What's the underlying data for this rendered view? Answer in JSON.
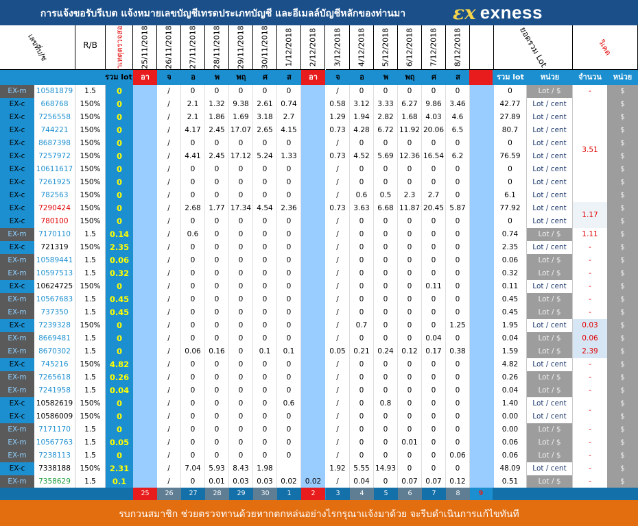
{
  "banner": {
    "text": "การแจ้งขอรับรีเบต   แจ้งหมายเลขบัญชีเทรดประเภทบัญชี และอีเมลล์บัญชีหลักของท่านมา",
    "brand_icon": "ex-logo-icon",
    "brand_name": "exness"
  },
  "headers": {
    "account": "เลขที่บ/ช",
    "rb": "R/B",
    "monthly": "สาเหตุตรวจสอบ",
    "dates": [
      "25/11/2018",
      "26/11/2018",
      "27/11/2018",
      "28/11/2018",
      "29/11/2018",
      "30/11/2018",
      "1/12/2018",
      "2/12/2018",
      "3/12/2018",
      "4/12/2018",
      "5/12/2018",
      "6/12/2018",
      "7/12/2018",
      "8/12/2018"
    ],
    "total": "ยอดรวม Lot",
    "withdraw": "วิเคด"
  },
  "dayrow": {
    "sum_label": "รวม lot",
    "days": [
      "อา",
      "จ",
      "อ",
      "พ",
      "พฤ",
      "ศ",
      "ส",
      "อา",
      "จ",
      "อ",
      "พ",
      "พฤ",
      "ศ",
      "ส"
    ],
    "total_label": "รวม lot",
    "unit_label": "หน่วย",
    "amount_label": "จำนวนเงิน",
    "currency_label": "หน่วย"
  },
  "rows": [
    {
      "type": "EX-m",
      "acc": "10581879",
      "rb": "1.5",
      "sum": "0",
      "d": [
        "",
        "/",
        "0",
        "0",
        "0",
        "0",
        "0",
        "",
        "/",
        "0",
        "0",
        "0",
        "0",
        "0"
      ],
      "tot": "0",
      "unit": "Lot / $",
      "amt": "-",
      "cur": "$"
    },
    {
      "type": "EX-c",
      "acc": "668768",
      "rb": "150%",
      "sum": "0",
      "d": [
        "",
        "/",
        "2.1",
        "1.32",
        "9.38",
        "2.61",
        "0.74",
        "",
        "0.58",
        "3.12",
        "3.33",
        "6.27",
        "9.86",
        "3.46"
      ],
      "tot": "42.77",
      "unit": "Lot / cent",
      "amt": "",
      "cur": "$"
    },
    {
      "type": "EX-c",
      "acc": "7256558",
      "rb": "150%",
      "sum": "0",
      "d": [
        "",
        "/",
        "2.1",
        "1.86",
        "1.69",
        "3.18",
        "2.7",
        "",
        "1.29",
        "1.94",
        "2.82",
        "1.68",
        "4.03",
        "4.6"
      ],
      "tot": "27.89",
      "unit": "Lot / cent",
      "amt": "",
      "cur": "$"
    },
    {
      "type": "EX-c",
      "acc": "744221",
      "rb": "150%",
      "sum": "0",
      "d": [
        "",
        "/",
        "4.17",
        "2.45",
        "17.07",
        "2.65",
        "4.15",
        "",
        "0.73",
        "4.28",
        "6.72",
        "11.92",
        "20.06",
        "6.5"
      ],
      "tot": "80.7",
      "unit": "Lot / cent",
      "amt": "",
      "cur": "$"
    },
    {
      "type": "EX-c",
      "acc": "8687398",
      "rb": "150%",
      "sum": "0",
      "d": [
        "",
        "/",
        "0",
        "0",
        "0",
        "0",
        "0",
        "",
        "/",
        "0",
        "0",
        "0",
        "0",
        "0"
      ],
      "tot": "0",
      "unit": "Lot / cent",
      "amt": "",
      "cur": "$"
    },
    {
      "type": "EX-c",
      "acc": "7257972",
      "rb": "150%",
      "sum": "0",
      "d": [
        "",
        "/",
        "4.41",
        "2.45",
        "17.12",
        "5.24",
        "1.33",
        "",
        "0.73",
        "4.52",
        "5.69",
        "12.36",
        "16.54",
        "6.2"
      ],
      "tot": "76.59",
      "unit": "Lot / cent",
      "amt": "",
      "cur": "$"
    },
    {
      "type": "EX-c",
      "acc": "10611617",
      "rb": "150%",
      "sum": "0",
      "d": [
        "",
        "/",
        "0",
        "0",
        "0",
        "0",
        "0",
        "",
        "/",
        "0",
        "0",
        "0",
        "0",
        "0"
      ],
      "tot": "0",
      "unit": "Lot / cent",
      "amt": "",
      "cur": "$"
    },
    {
      "type": "EX-c",
      "acc": "7261925",
      "rb": "150%",
      "sum": "0",
      "d": [
        "",
        "/",
        "0",
        "0",
        "0",
        "0",
        "0",
        "",
        "/",
        "0",
        "0",
        "0",
        "0",
        "0"
      ],
      "tot": "0",
      "unit": "Lot / cent",
      "amt": "",
      "cur": "$"
    },
    {
      "type": "EX-c",
      "acc": "782563",
      "rb": "150%",
      "sum": "0",
      "d": [
        "",
        "/",
        "0",
        "0",
        "0",
        "0",
        "0",
        "",
        "/",
        "0.6",
        "0.5",
        "2.3",
        "2.7",
        "0"
      ],
      "tot": "6.1",
      "unit": "Lot / cent",
      "amt": "",
      "cur": "$"
    },
    {
      "type": "EX-c",
      "acc": "7290424",
      "rb": "150%",
      "sum": "0",
      "d": [
        "",
        "/",
        "2.68",
        "1.77",
        "17.34",
        "4.54",
        "2.36",
        "",
        "0.73",
        "3.63",
        "6.68",
        "11.87",
        "20.45",
        "5.87"
      ],
      "tot": "77.92",
      "unit": "Lot / cent",
      "amt": "",
      "cur": "$"
    },
    {
      "type": "EX-c",
      "acc": "780100",
      "rb": "150%",
      "sum": "0",
      "d": [
        "",
        "/",
        "0",
        "0",
        "0",
        "0",
        "0",
        "",
        "/",
        "0",
        "0",
        "0",
        "0",
        "0"
      ],
      "tot": "0",
      "unit": "Lot / cent",
      "amt": "",
      "cur": "$"
    },
    {
      "type": "EX-m",
      "acc": "7170110",
      "rb": "1.5",
      "sum": "0.14",
      "d": [
        "",
        "/",
        "0.6",
        "0",
        "0",
        "0",
        "0",
        "",
        "/",
        "0",
        "0",
        "0",
        "0",
        "0"
      ],
      "tot": "0.74",
      "unit": "Lot / $",
      "amt": "1.11",
      "cur": "$"
    },
    {
      "type": "EX-c",
      "acc": "721319",
      "rb": "150%",
      "sum": "2.35",
      "d": [
        "",
        "/",
        "0",
        "0",
        "0",
        "0",
        "0",
        "",
        "/",
        "0",
        "0",
        "0",
        "0",
        "0"
      ],
      "tot": "2.35",
      "unit": "Lot / cent",
      "amt": "-",
      "cur": "$"
    },
    {
      "type": "EX-m",
      "acc": "10589441",
      "rb": "1.5",
      "sum": "0.06",
      "d": [
        "",
        "/",
        "0",
        "0",
        "0",
        "0",
        "0",
        "",
        "/",
        "0",
        "0",
        "0",
        "0",
        "0"
      ],
      "tot": "0.06",
      "unit": "Lot / $",
      "amt": "-",
      "cur": "$"
    },
    {
      "type": "EX-m",
      "acc": "10597513",
      "rb": "1.5",
      "sum": "0.32",
      "d": [
        "",
        "/",
        "0",
        "0",
        "0",
        "0",
        "0",
        "",
        "/",
        "0",
        "0",
        "0",
        "0",
        "0"
      ],
      "tot": "0.32",
      "unit": "Lot / $",
      "amt": "-",
      "cur": "$"
    },
    {
      "type": "EX-c",
      "acc": "10624725",
      "rb": "150%",
      "sum": "0",
      "d": [
        "",
        "/",
        "0",
        "0",
        "0",
        "0",
        "0",
        "",
        "/",
        "0",
        "0",
        "0",
        "0.11",
        "0"
      ],
      "tot": "0.11",
      "unit": "Lot / cent",
      "amt": "-",
      "cur": "$"
    },
    {
      "type": "EX-m",
      "acc": "10567683",
      "rb": "1.5",
      "sum": "0.45",
      "d": [
        "",
        "/",
        "0",
        "0",
        "0",
        "0",
        "0",
        "",
        "/",
        "0",
        "0",
        "0",
        "0",
        "0"
      ],
      "tot": "0.45",
      "unit": "Lot / $",
      "amt": "-",
      "cur": "$"
    },
    {
      "type": "EX-m",
      "acc": "737350",
      "rb": "1.5",
      "sum": "0.45",
      "d": [
        "",
        "/",
        "0",
        "0",
        "0",
        "0",
        "0",
        "",
        "/",
        "0",
        "0",
        "0",
        "0",
        "0"
      ],
      "tot": "0.45",
      "unit": "Lot / $",
      "amt": "-",
      "cur": "$"
    },
    {
      "type": "EX-c",
      "acc": "7239328",
      "rb": "150%",
      "sum": "0",
      "d": [
        "",
        "/",
        "0",
        "0",
        "0",
        "0",
        "0",
        "",
        "/",
        "0.7",
        "0",
        "0",
        "0",
        "1.25"
      ],
      "tot": "1.95",
      "unit": "Lot / cent",
      "amt": "0.03",
      "cur": "$"
    },
    {
      "type": "EX-m",
      "acc": "8669481",
      "rb": "1.5",
      "sum": "0",
      "d": [
        "",
        "/",
        "0",
        "0",
        "0",
        "0",
        "0",
        "",
        "/",
        "0",
        "0",
        "0",
        "0.04",
        "0"
      ],
      "tot": "0.04",
      "unit": "Lot / $",
      "amt": "0.06",
      "cur": "$"
    },
    {
      "type": "EX-m",
      "acc": "8670302",
      "rb": "1.5",
      "sum": "0",
      "d": [
        "",
        "/",
        "0.06",
        "0.16",
        "0",
        "0.1",
        "0.1",
        "",
        "0.05",
        "0.21",
        "0.24",
        "0.12",
        "0.17",
        "0.38"
      ],
      "tot": "1.59",
      "unit": "Lot / $",
      "amt": "2.39",
      "cur": "$"
    },
    {
      "type": "EX-c",
      "acc": "745216",
      "rb": "150%",
      "sum": "4.82",
      "d": [
        "",
        "/",
        "0",
        "0",
        "0",
        "0",
        "0",
        "",
        "/",
        "0",
        "0",
        "0",
        "0",
        "0"
      ],
      "tot": "4.82",
      "unit": "Lot / cent",
      "amt": "-",
      "cur": "$"
    },
    {
      "type": "EX-m",
      "acc": "7265618",
      "rb": "1.5",
      "sum": "0.26",
      "d": [
        "",
        "/",
        "0",
        "0",
        "0",
        "0",
        "0",
        "",
        "/",
        "0",
        "0",
        "0",
        "0",
        "0"
      ],
      "tot": "0.26",
      "unit": "Lot / $",
      "amt": "-",
      "cur": "$"
    },
    {
      "type": "EX-m",
      "acc": "7241958",
      "rb": "1.5",
      "sum": "0.04",
      "d": [
        "",
        "/",
        "0",
        "0",
        "0",
        "0",
        "0",
        "",
        "/",
        "0",
        "0",
        "0",
        "0",
        "0"
      ],
      "tot": "0.04",
      "unit": "Lot / $",
      "amt": "-",
      "cur": "$"
    },
    {
      "type": "EX-c",
      "acc": "10582619",
      "rb": "150%",
      "sum": "0",
      "d": [
        "",
        "/",
        "0",
        "0",
        "0",
        "0",
        "0.6",
        "",
        "/",
        "0",
        "0.8",
        "0",
        "0",
        "0"
      ],
      "tot": "1.40",
      "unit": "Lot / cent",
      "amt": "",
      "cur": "$"
    },
    {
      "type": "EX-c",
      "acc": "10586009",
      "rb": "150%",
      "sum": "0",
      "d": [
        "",
        "/",
        "0",
        "0",
        "0",
        "0",
        "0",
        "",
        "/",
        "0",
        "0",
        "0",
        "0",
        "0"
      ],
      "tot": "0.00",
      "unit": "Lot / cent",
      "amt": "",
      "cur": "$"
    },
    {
      "type": "EX-m",
      "acc": "7171170",
      "rb": "1.5",
      "sum": "0",
      "d": [
        "",
        "/",
        "0",
        "0",
        "0",
        "0",
        "0",
        "",
        "/",
        "0",
        "0",
        "0",
        "0",
        "0"
      ],
      "tot": "0.00",
      "unit": "Lot / $",
      "amt": "-",
      "cur": "$"
    },
    {
      "type": "EX-m",
      "acc": "10567763",
      "rb": "1.5",
      "sum": "0.05",
      "d": [
        "",
        "/",
        "0",
        "0",
        "0",
        "0",
        "0",
        "",
        "/",
        "0",
        "0",
        "0.01",
        "0",
        "0"
      ],
      "tot": "0.06",
      "unit": "Lot / $",
      "amt": "-",
      "cur": "$"
    },
    {
      "type": "EX-m",
      "acc": "7238113",
      "rb": "1.5",
      "sum": "0",
      "d": [
        "",
        "/",
        "0",
        "0",
        "0",
        "0",
        "0",
        "",
        "/",
        "0",
        "0",
        "0",
        "0",
        "0.06"
      ],
      "tot": "0.06",
      "unit": "Lot / $",
      "amt": "-",
      "cur": "$"
    },
    {
      "type": "EX-c",
      "acc": "7338188",
      "rb": "150%",
      "sum": "2.31",
      "d": [
        "",
        "/",
        "7.04",
        "5.93",
        "8.43",
        "1.98",
        "",
        "",
        "1.92",
        "5.55",
        "14.93",
        "0",
        "0",
        "0"
      ],
      "tot": "48.09",
      "unit": "Lot / cent",
      "amt": "-",
      "cur": "$"
    },
    {
      "type": "EX-m",
      "acc": "7358629",
      "rb": "1.5",
      "sum": "0.1",
      "d": [
        "",
        "/",
        "0",
        "0.01",
        "0.03",
        "0.03",
        "0.02",
        "0.02",
        "/",
        "0.04",
        "0",
        "0.07",
        "0.07",
        "0.12"
      ],
      "tot": "0.51",
      "unit": "Lot / $",
      "amt": "-",
      "cur": "$"
    }
  ],
  "merged_amounts": [
    {
      "text": "3.51",
      "first_row": 1,
      "last_row": 8
    },
    {
      "text": "1.17",
      "first_row": 9,
      "last_row": 10
    },
    {
      "text": "-",
      "first_row": 24,
      "last_row": 25
    }
  ],
  "footer_days": [
    "25",
    "26",
    "27",
    "28",
    "29",
    "30",
    "1",
    "2",
    "3",
    "4",
    "5",
    "6",
    "7",
    "8",
    "9"
  ],
  "bottom_text": "รบกวนสมาชิก ช่วยตรวจทานด้วยหากตกหล่นอย่างไรกรุณาแจ้งมาด้วย จะรีบดำเนินการแก้ไขทันที",
  "colors": {
    "header_blue": "#1a4f8a",
    "table_blue": "#1c8fd0",
    "light_blue": "#99ccff",
    "sunday_red": "#e81c1c",
    "bottom_orange": "#e26e10",
    "grey": "#9d9d9d"
  }
}
